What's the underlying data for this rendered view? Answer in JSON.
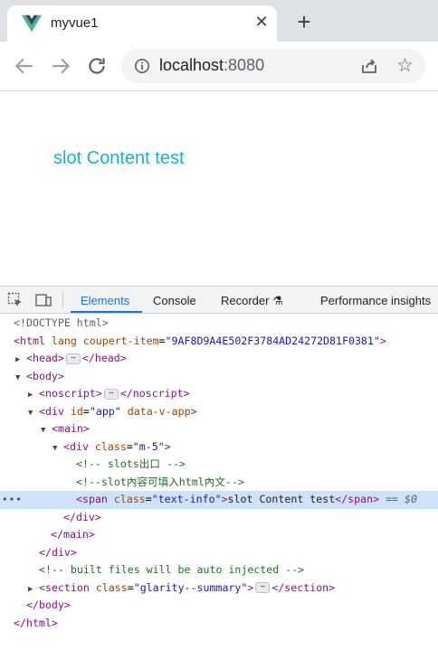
{
  "browser": {
    "tab_title": "myvue1",
    "tab_close": "✕",
    "new_tab": "+",
    "url_host": "localhost",
    "url_port": ":8080",
    "icons": {
      "back": "arrow-left-icon",
      "forward": "arrow-right-icon",
      "reload": "reload-icon",
      "info": "info-icon",
      "share": "share-icon",
      "bookmark": "star-icon",
      "favicon": "vue-logo-icon"
    },
    "colors": {
      "vue_green": "#42b883",
      "vue_dark": "#35495e",
      "page_text": "#1ab0d6",
      "accent": "#1a73e8"
    }
  },
  "page": {
    "slot_text": "slot Content test"
  },
  "devtools": {
    "tabs": {
      "elements": "Elements",
      "console": "Console",
      "recorder": "Recorder",
      "recorder_icon": "⚗",
      "performance": "Performance insights"
    },
    "dots": "•••",
    "ellipsis": "⋯",
    "tree": {
      "doctype": "<!DOCTYPE html>",
      "html_open": "<html",
      "html_attr": "lang",
      "html_attr2": "coupert-item",
      "html_attr2_val": "\"9AF8D9A4E502F3784AD24272D81F0381\"",
      "gt": ">",
      "head_open": "<head>",
      "head_close": "</head>",
      "body_open": "<body>",
      "noscript_open": "<noscript>",
      "noscript_close": "</noscript>",
      "div_open": "<div",
      "id_attr": "id",
      "id_val": "\"app\"",
      "data_attr": "data-v-app",
      "main_open": "<main>",
      "class_attr": "class",
      "class_val_m5": "\"m-5\"",
      "comment1": "<!-- slots出口 -->",
      "comment2": "<!--slot內容可填入html內文-->",
      "span_open": "<span",
      "class_val_text": "\"text-info\"",
      "span_text": "slot Content test",
      "span_close": "</span>",
      "eq_sel": "== $0",
      "div_close": "</div>",
      "main_close": "</main>",
      "comment3": "<!-- built files will be auto injected -->",
      "section_open": "<section",
      "class_val_section": "\"glarity--summary\"",
      "section_close": "</section>",
      "body_close": "</body>",
      "html_close": "</html>"
    }
  }
}
